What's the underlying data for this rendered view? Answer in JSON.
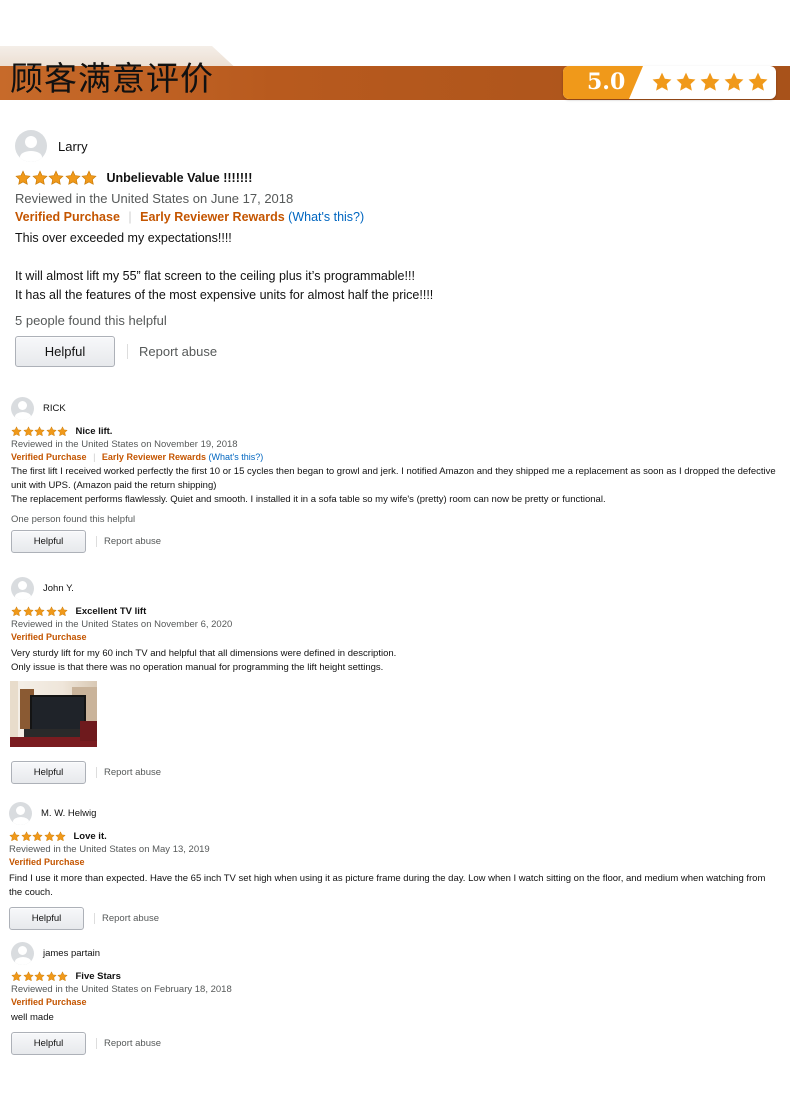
{
  "header": {
    "title": "顾客满意评价",
    "score": "5.0",
    "star_color": "#f0991a"
  },
  "reviews": [
    {
      "name": "Larry",
      "title": "Unbelievable Value !!!!!!!",
      "rating": 5,
      "date": "Reviewed in the United States on June 17, 2018",
      "verified": "Verified Purchase",
      "early": "Early Reviewer Rewards",
      "whats_this": "(What's this?)",
      "body": [
        "This over exceeded my expectations!!!!",
        "",
        "It will almost lift my 55” flat screen to the ceiling plus it’s programmable!!!",
        "It has all the features of the most expensive units for almost half the price!!!!"
      ],
      "helpful_count": "5 people found this helpful",
      "helpful_label": "Helpful",
      "report_label": "Report abuse"
    },
    {
      "name": "RICK",
      "title": "Nice lift.",
      "rating": 5,
      "date": "Reviewed in the United States on November 19, 2018",
      "verified": "Verified Purchase",
      "early": "Early Reviewer Rewards",
      "whats_this": "(What's this?)",
      "body": [
        "The first lift I received worked perfectly the first 10 or 15 cycles then began to growl and jerk. I notified Amazon and they shipped me a replacement as soon as I dropped the defective unit with UPS. (Amazon paid the return shipping)",
        "The replacement performs flawlessly. Quiet and smooth. I installed it in a sofa table so my wife's (pretty) room can now be pretty or functional."
      ],
      "helpful_count": "One person found this helpful",
      "helpful_label": "Helpful",
      "report_label": "Report abuse"
    },
    {
      "name": "John Y.",
      "title": "Excellent TV lift",
      "rating": 5,
      "date": "Reviewed in the United States on November 6, 2020",
      "verified": "Verified Purchase",
      "body": [
        "Very sturdy lift for my 60 inch TV and helpful that all dimensions were defined in description.",
        "Only issue is that there was no operation manual for programming the lift height settings."
      ],
      "helpful_label": "Helpful",
      "report_label": "Report abuse"
    },
    {
      "name": "M. W. Helwig",
      "title": "Love it.",
      "rating": 5,
      "date": "Reviewed in the United States on May 13, 2019",
      "verified": "Verified Purchase",
      "body": [
        "Find I use it more than expected. Have the 65 inch TV set high when using it as picture frame during the day. Low when I watch sitting on the floor, and medium when watching from the couch."
      ],
      "helpful_label": "Helpful",
      "report_label": "Report abuse"
    },
    {
      "name": "james partain",
      "title": "Five Stars",
      "rating": 5,
      "date": "Reviewed in the United States on February 18, 2018",
      "verified": "Verified Purchase",
      "body": [
        "well made"
      ],
      "helpful_label": "Helpful",
      "report_label": "Report abuse"
    }
  ]
}
